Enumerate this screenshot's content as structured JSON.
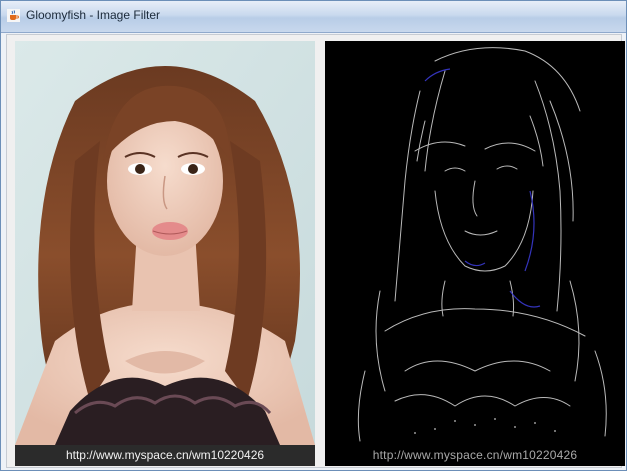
{
  "window": {
    "title": "Gloomyfish - Image Filter",
    "icon": "java-cup-icon"
  },
  "panels": {
    "original": {
      "image": "photo-portrait",
      "caption": "http://www.myspace.cn/wm10220426"
    },
    "filtered": {
      "image": "edge-detected-portrait",
      "caption": "http://www.myspace.cn/wm10220426"
    }
  },
  "colors": {
    "titlebar": "#c9d9ee",
    "edge_background": "#000000",
    "edge_lines": "#d8d8d8",
    "edge_accent": "#3a3ad0"
  }
}
